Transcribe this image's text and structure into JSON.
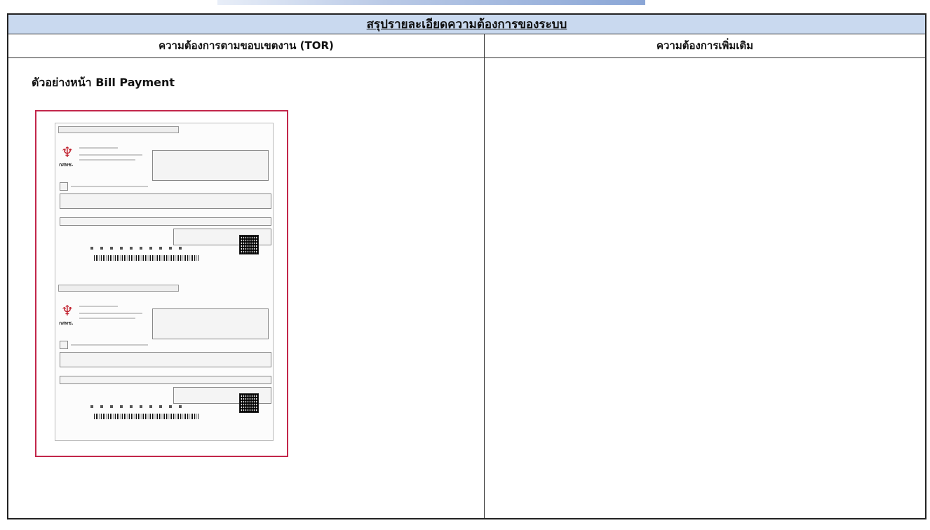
{
  "document": {
    "header_title": "สรุปรายละเอียดความต้องการของระบบ",
    "col_left_title": "ความต้องการตามขอบเขตงาน (TOR)",
    "col_right_title": "ความต้องการเพิ่มเติม",
    "example_title": "ตัวอย่างหน้า Bill Payment"
  },
  "preview": {
    "logo_text": "กสทช.",
    "logo_icon": "garuda-emblem-icon",
    "accent_color": "#c2264a"
  },
  "colors": {
    "header_bg": "#c9d9ef"
  }
}
